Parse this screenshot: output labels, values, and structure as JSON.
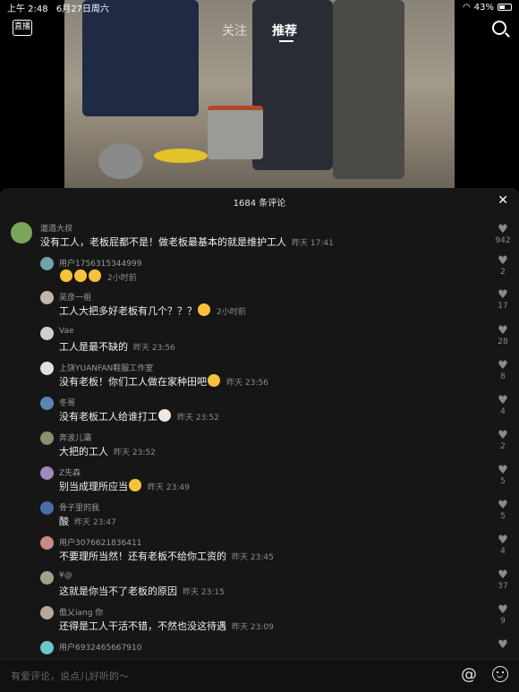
{
  "status_bar": {
    "time": "上午 2:48",
    "date": "6月27日周六",
    "battery": "43%"
  },
  "nav": {
    "live_label": "直播",
    "tabs": [
      "关注",
      "推荐"
    ],
    "active_tab": "推荐"
  },
  "panel": {
    "title": "1684 条评论"
  },
  "comments": [
    {
      "user": "邋遢大叔",
      "text": "没有工人，老板屁都不是！做老板最基本的就是维护工人",
      "time": "昨天 17:41",
      "likes": "942",
      "avatar_color": "#7aa55a",
      "top": true
    },
    {
      "user": "用户1756315344999",
      "text": "",
      "time": "2小时前",
      "likes": "2",
      "avatar_color": "#6fa3a8",
      "emojis": 3
    },
    {
      "user": "吴彦一祖",
      "text": "工人大把多好老板有几个？？？",
      "time": "2小时前",
      "likes": "17",
      "avatar_color": "#c2b7a6",
      "emojis": 1
    },
    {
      "user": "Vae",
      "text": "工人是最不缺的",
      "time": "昨天 23:56",
      "likes": "28",
      "avatar_color": "#cfcfcf"
    },
    {
      "user": "上饶YUANFAN鞋服工作室",
      "text": "没有老板！你们工人做在家种田吧",
      "time": "昨天 23:56",
      "likes": "8",
      "avatar_color": "#e0e0e0",
      "emojis": 1
    },
    {
      "user": "冬哥",
      "text": "没有老板工人给谁打工",
      "time": "昨天 23:52",
      "likes": "4",
      "avatar_color": "#5a85b5",
      "emojis": 1,
      "cat": true
    },
    {
      "user": "奔波儿灞",
      "text": "大把的工人",
      "time": "昨天 23:52",
      "likes": "2",
      "avatar_color": "#8e8e6e"
    },
    {
      "user": "Z先森",
      "text": "别当成理所应当",
      "time": "昨天 23:49",
      "likes": "5",
      "avatar_color": "#a08ab8",
      "emojis": 1
    },
    {
      "user": "骨子里的我",
      "text": "酸",
      "time": "昨天 23:47",
      "likes": "5",
      "avatar_color": "#4a6fa8"
    },
    {
      "user": "用户3076621836411",
      "text": "不要理所当然！还有老板不给你工资的",
      "time": "昨天 23:45",
      "likes": "4",
      "avatar_color": "#c98a8a"
    },
    {
      "user": "¥@",
      "text": "这就是你当不了老板的原因",
      "time": "昨天 23:15",
      "likes": "37",
      "avatar_color": "#9aa58c"
    },
    {
      "user": "儋乂iang 你",
      "text": "还得是工人干活不错，不然也没这待遇",
      "time": "昨天 23:09",
      "likes": "9",
      "avatar_color": "#b8a89a"
    },
    {
      "user": "用户6932465667910",
      "text": "",
      "time": "",
      "likes": "",
      "avatar_color": "#6cc7c7"
    }
  ],
  "input": {
    "placeholder": "有爱评论，说点儿好听的～"
  },
  "icons": {
    "at": "@"
  }
}
